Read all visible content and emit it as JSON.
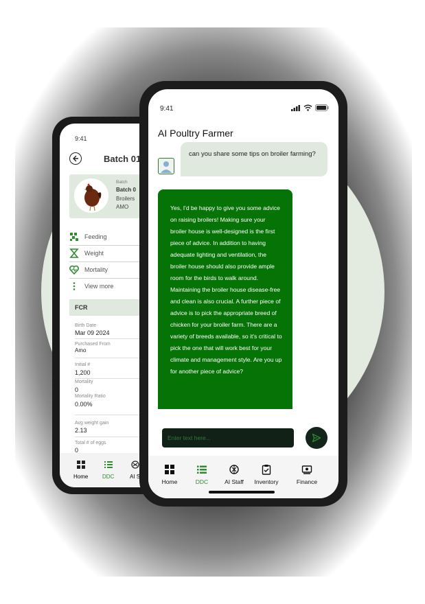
{
  "colors": {
    "accent": "#067306",
    "nav_active": "#2e8b2e",
    "card_bg": "#dfe9dd"
  },
  "back_screen": {
    "time": "9:41",
    "title": "Batch 01",
    "card": {
      "batch_label": "Batch",
      "batch_name": "Batch 0",
      "breed": "Broilers",
      "source": "AMO"
    },
    "menu": [
      {
        "label": "Feeding",
        "icon": "feeding-icon"
      },
      {
        "label": "Weight",
        "icon": "weight-icon"
      },
      {
        "label": "Mortality",
        "icon": "mortality-icon"
      },
      {
        "label": "View more",
        "icon": "more-vertical-icon"
      }
    ],
    "fcr_label": "FCR",
    "details": {
      "birth_date_label": "Birth Date",
      "birth_date": "Mar 09 2024",
      "purchased_from_label": "Purchased From",
      "purchased_from": "Amo",
      "initial_label": "Initial #",
      "initial": "1,200",
      "mortality_label": "Mortality",
      "mortality": "0",
      "mortality_ratio_label": "Mortality Ratio",
      "mortality_ratio": "0.00%",
      "avg_weight_gain_label": "Avg weight gain",
      "avg_weight_gain": "2.13",
      "total_eggs_label": "Total # of eggs",
      "total_eggs": "0"
    },
    "nav": {
      "home": "Home",
      "ddc": "DDC",
      "ai": "AI S"
    }
  },
  "front_screen": {
    "time": "9:41",
    "title": "AI Poultry Farmer",
    "user_message": "can you share some tips on broiler farming?",
    "bot_message": "Yes, I'd be happy to give you some advice on raising broilers! Making sure your broiler house is well-designed is the first piece of advice. In addition to having adequate lighting and ventilation, the broiler house should also provide ample room for the birds to walk around. Maintaining the broiler house disease-free and clean is also crucial. A further piece of advice is to pick the appropriate breed of chicken for your broiler farm. There are a variety of breeds available, so it's critical to pick the one that will work best for your climate and management style. Are you up for another piece of advice?",
    "input_placeholder": "Enter text here...",
    "nav": [
      {
        "label": "Home",
        "icon": "home-grid-icon",
        "active": false
      },
      {
        "label": "DDC",
        "icon": "list-icon",
        "active": true
      },
      {
        "label": "AI Staff",
        "icon": "ai-knot-icon",
        "active": false
      },
      {
        "label": "Inventory",
        "icon": "clipboard-icon",
        "active": false
      },
      {
        "label": "Finance",
        "icon": "finance-icon",
        "active": false
      }
    ]
  }
}
